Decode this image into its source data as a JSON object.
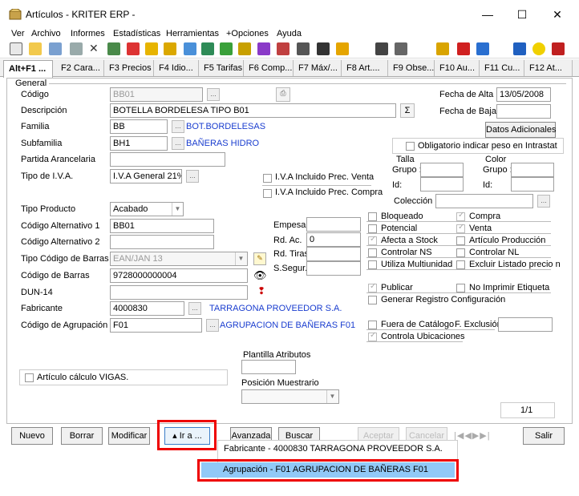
{
  "window": {
    "title": "Artículos - KRITER ERP -"
  },
  "menu": [
    "Ver",
    "Archivo",
    "Informes",
    "Estadísticas",
    "Herramientas",
    "+Opciones",
    "Ayuda"
  ],
  "tabs": [
    "Alt+F1 ...",
    "F2 Cara...",
    "F3 Precios",
    "F4 Idio...",
    "F5 Tarifas",
    "F6 Comp...",
    "F7 Máx/...",
    "F8 Art....",
    "F9 Obse...",
    "F10 Au...",
    "F11 Cu...",
    "F12 At..."
  ],
  "form": {
    "group_label": "General",
    "codigo_label": "Código",
    "codigo_value": "BB01",
    "descripcion_label": "Descripción",
    "descripcion_value": "BOTELLA BORDELESA TIPO B01",
    "sigma": "Σ",
    "familia_label": "Familia",
    "familia_value": "BB",
    "familia_desc": "BOT.BORDELESAS",
    "subfamilia_label": "Subfamilia",
    "subfamilia_value": "BH1",
    "subfamilia_desc": "BAÑERAS HIDRO",
    "partida_label": "Partida Arancelaria",
    "iva_label": "Tipo de I.V.A.",
    "iva_value": "I.V.A General 21% -",
    "iva_venta_label": "I.V.A Incluido Prec. Venta",
    "iva_compra_label": "I.V.A Incluido Prec. Compra",
    "fecha_alta_label": "Fecha de Alta",
    "fecha_alta_value": "13/05/2008",
    "fecha_baja_label": "Fecha de Baja",
    "datos_adicionales": "Datos Adicionales",
    "intrastat_label": "Obligatorio indicar peso en Intrastat",
    "talla_label": "Talla",
    "color_label": "Color",
    "grupo_label": "Grupo :",
    "id_label": "Id:",
    "coleccion_label": "Colección",
    "tipo_producto_label": "Tipo Producto",
    "tipo_producto_value": "Acabado",
    "cod_alt1_label": "Código Alternativo 1",
    "cod_alt1_value": "BB01",
    "cod_alt2_label": "Código Alternativo 2",
    "tipo_barras_label": "Tipo Código de Barras",
    "tipo_barras_value": "EAN/JAN 13",
    "cod_barras_label": "Código de Barras",
    "cod_barras_value": "9728000000004",
    "dun_label": "DUN-14",
    "fabricante_label": "Fabricante",
    "fabricante_value": "4000830",
    "fabricante_desc": "TARRAGONA PROVEEDOR S.A.",
    "agrupacion_label": "Código de Agrupación",
    "agrupacion_value": "F01",
    "agrupacion_desc": "AGRUPACION DE BAÑERAS F01",
    "empesa_label": "Empesa",
    "rdac_label": "Rd. Ac.",
    "rdac_value": "0",
    "rdtiras_label": "Rd. Tiras",
    "sseg_label": "S.Segur.",
    "bloqueado": "Bloqueado",
    "potencial": "Potencial",
    "afecta_stock": "Afecta a Stock",
    "controlar_ns": "Controlar NS",
    "multiunidad": "Utiliza Multiunidad",
    "compra": "Compra",
    "venta": "Venta",
    "articulo_produccion": "Artículo Producción",
    "controlar_nl": "Controlar NL",
    "excluir_listado": "Excluir Listado precio n",
    "publicar": "Publicar",
    "no_imprimir": "No Imprimir Etiqueta",
    "generar_registro": "Generar Registro Configuración",
    "fuera_catalogo": "Fuera de Catálogo",
    "f_exclusion": "F. Exclusión",
    "controla_ubicaciones": "Controla Ubicaciones",
    "plantilla_label": "Plantilla Atributos",
    "posicion_label": "Posición Muestrario",
    "vigas_label": "Artículo cálculo VIGAS.",
    "page_counter": "1/1"
  },
  "buttons": {
    "nuevo": "Nuevo",
    "borrar": "Borrar",
    "modificar": "Modificar",
    "ira": "Ir a ...",
    "avanzada": "Avanzada",
    "buscar": "Buscar",
    "aceptar": "Aceptar",
    "cancelar": "Cancelar",
    "salir": "Salir"
  },
  "dropdown": {
    "item1": "Fabricante - 4000830 TARRAGONA PROVEEDOR S.A.",
    "item2": "Agrupación - F01 AGRUPACION DE BAÑERAS F01"
  },
  "colors": {
    "link": "#1a3dcf",
    "highlight": "#e00000",
    "selected_item": "#91c9f7"
  }
}
